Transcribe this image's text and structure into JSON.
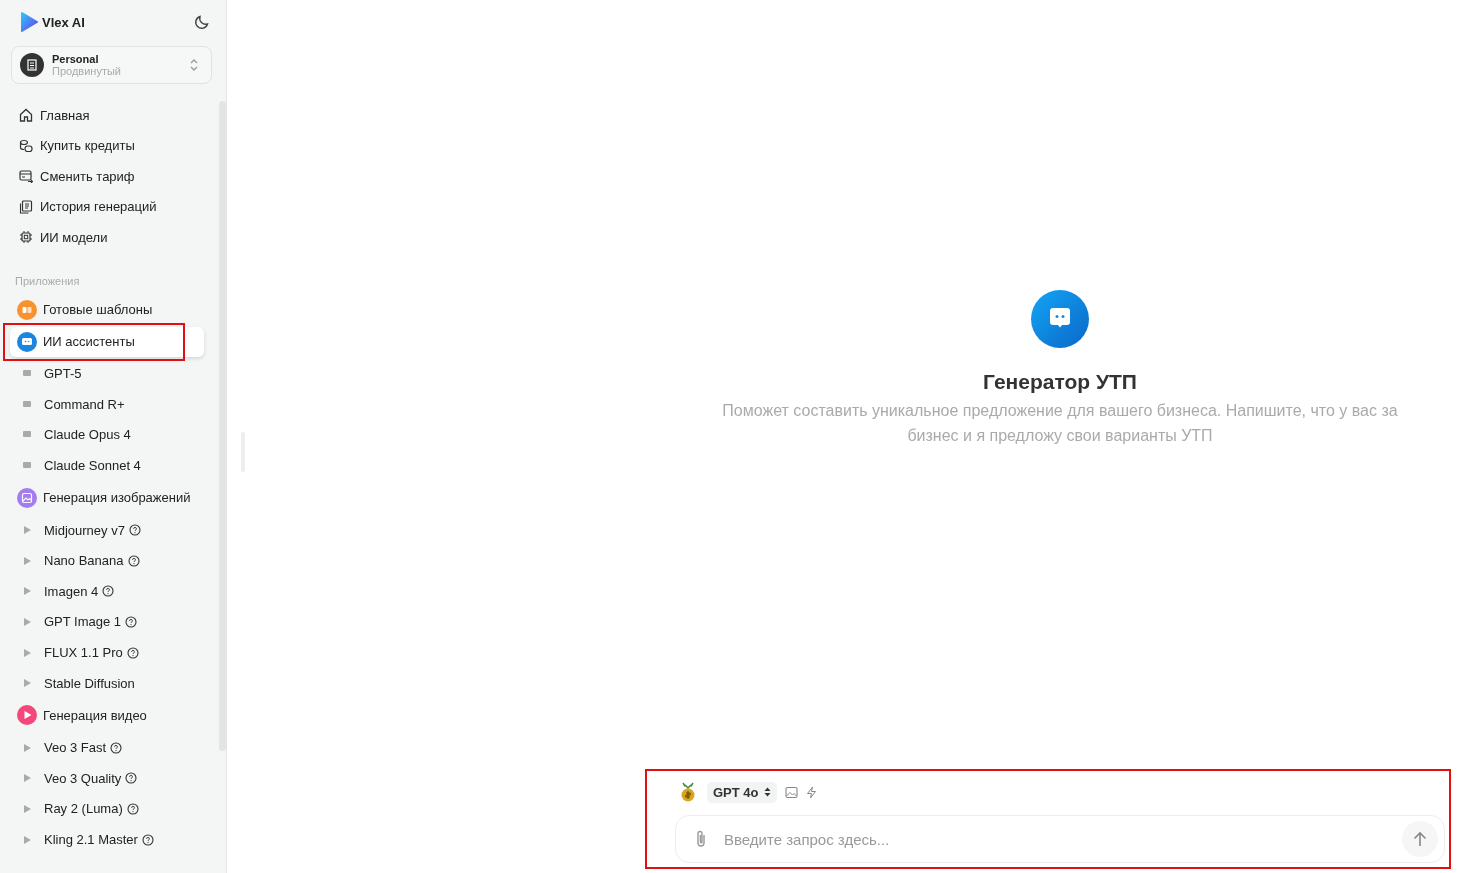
{
  "brand": {
    "name": "Vlex AI"
  },
  "workspace": {
    "name": "Personal",
    "plan": "Продвинутый"
  },
  "nav": [
    {
      "label": "Главная"
    },
    {
      "label": "Купить кредиты"
    },
    {
      "label": "Сменить тариф"
    },
    {
      "label": "История генераций"
    },
    {
      "label": "ИИ модели"
    }
  ],
  "apps_heading": "Приложения",
  "apps": [
    {
      "label": "Готовые шаблоны",
      "kind": "templates",
      "color": "#f7922f",
      "selected": false,
      "highlighted": false
    },
    {
      "label": "ИИ ассистенты",
      "kind": "chat",
      "color": "#1a86e0",
      "selected": true,
      "highlighted": true,
      "children": [
        {
          "label": "GPT-5",
          "help": false
        },
        {
          "label": "Command R+",
          "help": false
        },
        {
          "label": "Claude Opus 4",
          "help": false
        },
        {
          "label": "Claude Sonnet 4",
          "help": false
        }
      ]
    },
    {
      "label": "Генерация изображений",
      "kind": "image",
      "color": "#a57cf0",
      "selected": false,
      "highlighted": false,
      "children": [
        {
          "label": "Midjourney v7",
          "help": true
        },
        {
          "label": "Nano Banana",
          "help": true
        },
        {
          "label": "Imagen 4",
          "help": true
        },
        {
          "label": "GPT Image 1",
          "help": true
        },
        {
          "label": "FLUX 1.1 Pro",
          "help": true
        },
        {
          "label": "Stable Diffusion",
          "help": false
        }
      ]
    },
    {
      "label": "Генерация видео",
      "kind": "video",
      "color": "#f4487a",
      "selected": false,
      "highlighted": false,
      "children": [
        {
          "label": "Veo 3 Fast",
          "help": true
        },
        {
          "label": "Veo 3 Quality",
          "help": true
        },
        {
          "label": "Ray 2 (Luma)",
          "help": true
        },
        {
          "label": "Kling 2.1 Master",
          "help": true
        }
      ]
    }
  ],
  "assistant": {
    "title": "Генератор УТП",
    "description": "Поможет составить уникальное предложение для вашего бизнеса. Напишите, что у вас за бизнес и я предложу свои варианты УТП"
  },
  "composer": {
    "model": "GPT 4o",
    "placeholder": "Введите запрос здесь...",
    "highlighted": true
  }
}
